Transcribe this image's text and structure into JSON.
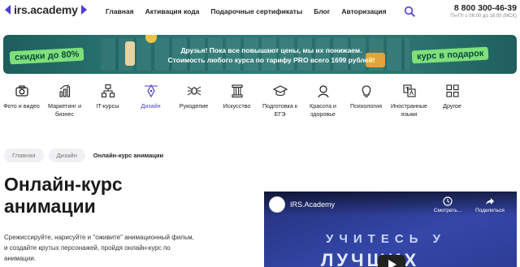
{
  "header": {
    "logo_text": "irs.academy",
    "nav": [
      "Главная",
      "Активация кода",
      "Подарочные сертификаты",
      "Блог",
      "Авторизация"
    ],
    "phone": "8 800 300-46-39",
    "hours": "Пн-Пт с 06:00 до 16:00 (МСК)"
  },
  "banner": {
    "badge_left": "скидки до 80%",
    "line1": "Друзья! Пока все повышают цены, мы их понижаем.",
    "line2": "Стоимость любого курса по тарифу PRO всего 1699 рублей!",
    "badge_right": "курс в подарок",
    "accent": "#7fe07a"
  },
  "categories": [
    {
      "label": "Фото и видео",
      "icon": "camera-icon"
    },
    {
      "label": "Маркетинг и бизнес",
      "icon": "chart-icon"
    },
    {
      "label": "IT-курсы",
      "icon": "network-icon"
    },
    {
      "label": "Дизайн",
      "icon": "pen-tool-icon",
      "active": true
    },
    {
      "label": "Рукоделие",
      "icon": "spider-icon"
    },
    {
      "label": "Искусство",
      "icon": "column-icon"
    },
    {
      "label": "Подготовка к ЕГЭ",
      "icon": "graduation-cap-icon"
    },
    {
      "label": "Красота и здоровье",
      "icon": "person-icon"
    },
    {
      "label": "Психология",
      "icon": "lightbulb-icon"
    },
    {
      "label": "Иностранные языки",
      "icon": "translate-icon"
    },
    {
      "label": "Другое",
      "icon": "grid-icon"
    }
  ],
  "breadcrumb": [
    "Главная",
    "Дизайн",
    "Онлайн-курс анимации"
  ],
  "page": {
    "title_line1": "Онлайн-курс",
    "title_line2": "анимации",
    "desc_line1": "Срежиссируйте, нарисуйте и \"оживите\" анимационный фильм,",
    "desc_line2": "и создайте крутых персонажей, пройдя онлайн-курс по",
    "desc_line3": "анимации."
  },
  "video": {
    "channel": "IRS.Academy",
    "watch_later": "Смотреть...",
    "share": "Поделиться",
    "overlay1": "УЧИТЕСЬ У",
    "overlay2": "ЛУЧШИХ"
  },
  "colors": {
    "brand": "#4b3fd1",
    "banner_bg": "#2a726f"
  }
}
